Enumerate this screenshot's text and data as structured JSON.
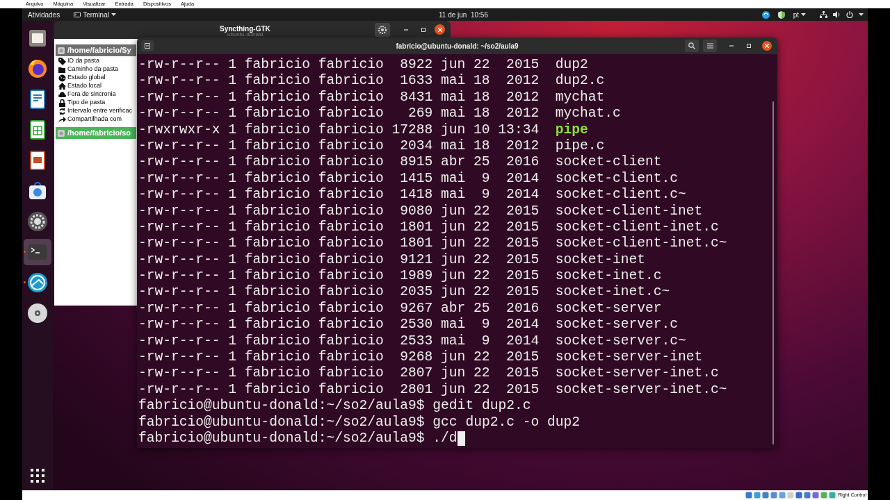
{
  "host_menu": [
    "Arquivo",
    "Máquina",
    "Visualizar",
    "Entrada",
    "Dispositivos",
    "Ajuda"
  ],
  "top_bar": {
    "activities": "Atividades",
    "app_menu": "Terminal",
    "clock": "11 de jun  10:56",
    "language": "pt"
  },
  "dock": [
    {
      "kind": "files",
      "running": false,
      "selected": false
    },
    {
      "kind": "firefox",
      "running": false,
      "selected": false
    },
    {
      "kind": "writer",
      "running": false,
      "selected": false
    },
    {
      "kind": "calc",
      "running": false,
      "selected": false
    },
    {
      "kind": "impress",
      "running": false,
      "selected": false
    },
    {
      "kind": "software",
      "running": false,
      "selected": false
    },
    {
      "kind": "settings",
      "running": false,
      "selected": false
    },
    {
      "kind": "terminal",
      "running": true,
      "selected": true
    },
    {
      "kind": "syncthing",
      "running": true,
      "selected": false
    },
    {
      "kind": "disc",
      "running": false,
      "selected": false
    }
  ],
  "syncthing_window": {
    "title": "Syncthing-GTK",
    "subtitle": "ubuntu-donald",
    "folders": [
      {
        "path": "/home/fabricio/Sy",
        "selected": false,
        "details": [
          {
            "kind": "tag",
            "label": "ID da pasta"
          },
          {
            "kind": "folder",
            "label": "Caminho da pasta"
          },
          {
            "kind": "globe",
            "label": "Estado global"
          },
          {
            "kind": "home",
            "label": "Estado local"
          },
          {
            "kind": "cloud",
            "label": "Fora de sincronia"
          },
          {
            "kind": "lock",
            "label": "Tipo de pasta"
          },
          {
            "kind": "refresh",
            "label": "Intervalo entre verificac"
          },
          {
            "kind": "share",
            "label": "Compartilhada com"
          }
        ]
      },
      {
        "path": "/home/fabricio/so",
        "selected": true
      }
    ]
  },
  "terminal_window": {
    "title": "fabricio@ubuntu-donald: ~/so2/aula9",
    "lines": [
      {
        "kind": "listing",
        "info": "-rw-r--r-- 1 fabricio fabricio  8922 jun 22  2015",
        "name": "dup2",
        "executable": false
      },
      {
        "kind": "listing",
        "info": "-rw-r--r-- 1 fabricio fabricio  1633 mai 18  2012",
        "name": "dup2.c",
        "executable": false
      },
      {
        "kind": "listing",
        "info": "-rw-r--r-- 1 fabricio fabricio  8431 mai 18  2012",
        "name": "mychat",
        "executable": false
      },
      {
        "kind": "listing",
        "info": "-rw-r--r-- 1 fabricio fabricio   269 mai 18  2012",
        "name": "mychat.c",
        "executable": false
      },
      {
        "kind": "listing",
        "info": "-rwxrwxr-x 1 fabricio fabricio 17288 jun 10 13:34",
        "name": "pipe",
        "executable": true
      },
      {
        "kind": "listing",
        "info": "-rw-r--r-- 1 fabricio fabricio  2034 mai 18  2012",
        "name": "pipe.c",
        "executable": false
      },
      {
        "kind": "listing",
        "info": "-rw-r--r-- 1 fabricio fabricio  8915 abr 25  2016",
        "name": "socket-client",
        "executable": false
      },
      {
        "kind": "listing",
        "info": "-rw-r--r-- 1 fabricio fabricio  1415 mai  9  2014",
        "name": "socket-client.c",
        "executable": false
      },
      {
        "kind": "listing",
        "info": "-rw-r--r-- 1 fabricio fabricio  1418 mai  9  2014",
        "name": "socket-client.c~",
        "executable": false
      },
      {
        "kind": "listing",
        "info": "-rw-r--r-- 1 fabricio fabricio  9080 jun 22  2015",
        "name": "socket-client-inet",
        "executable": false
      },
      {
        "kind": "listing",
        "info": "-rw-r--r-- 1 fabricio fabricio  1801 jun 22  2015",
        "name": "socket-client-inet.c",
        "executable": false
      },
      {
        "kind": "listing",
        "info": "-rw-r--r-- 1 fabricio fabricio  1801 jun 22  2015",
        "name": "socket-client-inet.c~",
        "executable": false
      },
      {
        "kind": "listing",
        "info": "-rw-r--r-- 1 fabricio fabricio  9121 jun 22  2015",
        "name": "socket-inet",
        "executable": false
      },
      {
        "kind": "listing",
        "info": "-rw-r--r-- 1 fabricio fabricio  1989 jun 22  2015",
        "name": "socket-inet.c",
        "executable": false
      },
      {
        "kind": "listing",
        "info": "-rw-r--r-- 1 fabricio fabricio  2035 jun 22  2015",
        "name": "socket-inet.c~",
        "executable": false
      },
      {
        "kind": "listing",
        "info": "-rw-r--r-- 1 fabricio fabricio  9267 abr 25  2016",
        "name": "socket-server",
        "executable": false
      },
      {
        "kind": "listing",
        "info": "-rw-r--r-- 1 fabricio fabricio  2530 mai  9  2014",
        "name": "socket-server.c",
        "executable": false
      },
      {
        "kind": "listing",
        "info": "-rw-r--r-- 1 fabricio fabricio  2533 mai  9  2014",
        "name": "socket-server.c~",
        "executable": false
      },
      {
        "kind": "listing",
        "info": "-rw-r--r-- 1 fabricio fabricio  9268 jun 22  2015",
        "name": "socket-server-inet",
        "executable": false
      },
      {
        "kind": "listing",
        "info": "-rw-r--r-- 1 fabricio fabricio  2807 jun 22  2015",
        "name": "socket-server-inet.c",
        "executable": false
      },
      {
        "kind": "listing",
        "info": "-rw-r--r-- 1 fabricio fabricio  2801 jun 22  2015",
        "name": "socket-server-inet.c~",
        "executable": false
      },
      {
        "kind": "prompt",
        "prompt": "fabricio@ubuntu-donald:~/so2/aula9$",
        "command": "gedit dup2.c"
      },
      {
        "kind": "prompt",
        "prompt": "fabricio@ubuntu-donald:~/so2/aula9$",
        "command": "gcc dup2.c -o dup2"
      },
      {
        "kind": "prompt",
        "prompt": "fabricio@ubuntu-donald:~/so2/aula9$",
        "command": "./d",
        "cursor": true
      }
    ]
  },
  "host_status": {
    "key_label": "Right Control"
  }
}
